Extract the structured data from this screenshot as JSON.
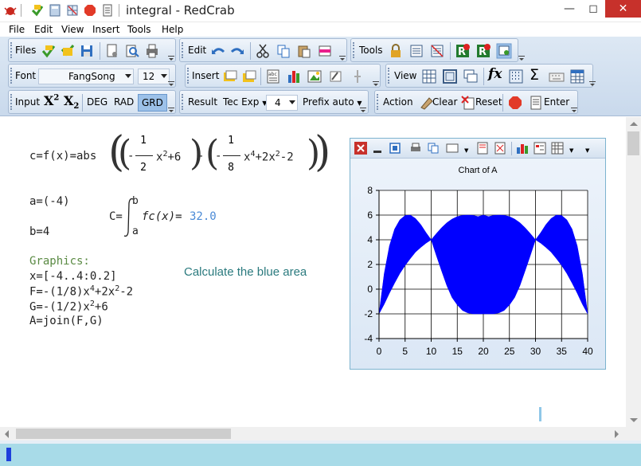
{
  "window": {
    "title": "integral - RedCrab"
  },
  "menu": [
    "File",
    "Edit",
    "View",
    "Insert",
    "Tools",
    "Help"
  ],
  "toolbar": {
    "files_label": "Files",
    "edit_label": "Edit",
    "tools_label": "Tools",
    "font_label": "Font",
    "font_family": "FangSong",
    "font_size": "12",
    "insert_label": "Insert",
    "view_label": "View",
    "input_label": "Input",
    "superscript_label": "X",
    "superscript_exp": "2",
    "subscript_label": "X",
    "subscript_idx": "2",
    "deg_label": "DEG",
    "rad_label": "RAD",
    "grd_label": "GRD",
    "result_label": "Result",
    "tec_exp_label": "Tec Exp",
    "precision_value": "4",
    "prefix_label": "Prefix auto",
    "action_label": "Action",
    "clear_label": "Clear",
    "reset_label": "Reset",
    "enter_label": "Enter"
  },
  "editor": {
    "c_def": {
      "lhs": "c=f(x)=abs",
      "frac1_num": "1",
      "frac1_den": "2",
      "term1": "x",
      "term1_exp": "2",
      "term1_rest": "+6",
      "minus": "-",
      "frac2_num": "1",
      "frac2_den": "8",
      "term2": "x",
      "term2_exp": "4",
      "term2_rest": "+2x",
      "term2_exp2": "2",
      "term2_end": "-2"
    },
    "a_def": "a=(-4)",
    "b_def": "b=4",
    "integral": {
      "lhs": "C=",
      "upper": "b",
      "lower": "a",
      "body": "fc(x)=",
      "result": "32.0"
    },
    "graphics_header": "Graphics:",
    "lines": {
      "x": "x=[-4..4:0.2]",
      "F_pre": "F=-(1/8)x",
      "F_exp1": "4",
      "F_mid": "+2x",
      "F_exp2": "2",
      "F_end": "-2",
      "G_pre": "G=-(1/2)x",
      "G_exp": "2",
      "G_end": "+6",
      "A": "A=join(F,G)"
    },
    "note": "Calculate the blue area"
  },
  "chart_data": {
    "type": "area",
    "title": "Chart of A",
    "xlabel": "",
    "ylabel": "",
    "xlim": [
      0,
      40
    ],
    "ylim": [
      -4,
      8
    ],
    "xticks": [
      0,
      5,
      10,
      15,
      20,
      25,
      30,
      35,
      40
    ],
    "yticks": [
      -4,
      -2,
      0,
      2,
      4,
      6,
      8
    ],
    "grid": true,
    "fill_color": "#0000ff",
    "description_series": [
      {
        "name": "",
        "x": [
          0,
          1,
          2,
          3,
          4,
          5,
          6,
          7,
          8,
          9,
          10,
          11,
          12,
          13,
          14,
          15,
          16,
          17,
          18,
          19,
          20,
          21,
          22,
          23,
          24,
          25,
          26,
          27,
          28,
          29,
          30,
          31,
          32,
          33,
          34,
          35,
          36,
          37,
          38,
          39,
          40
        ],
        "upper": [
          -2.0,
          1.26,
          3.51,
          4.87,
          5.62,
          5.97,
          6.0,
          5.73,
          5.23,
          4.58,
          4.0,
          4.51,
          4.98,
          5.38,
          5.68,
          5.88,
          5.98,
          6.0,
          5.98,
          5.88,
          6.0,
          5.88,
          5.98,
          6.0,
          5.98,
          5.88,
          5.68,
          5.38,
          4.98,
          4.51,
          4.0,
          4.58,
          5.23,
          5.73,
          6.0,
          5.97,
          5.62,
          4.87,
          3.51,
          1.26,
          -2.0
        ],
        "lower": [
          -2.0,
          -1.22,
          -0.32,
          0.5,
          1.28,
          1.92,
          2.48,
          3.0,
          3.38,
          3.72,
          4.0,
          2.7,
          1.48,
          0.28,
          -0.68,
          -1.28,
          -1.72,
          -1.92,
          -2.0,
          -2.0,
          -2.0,
          -2.0,
          -2.0,
          -1.92,
          -1.72,
          -1.28,
          -0.68,
          0.28,
          1.48,
          2.7,
          4.0,
          3.72,
          3.38,
          3.0,
          2.48,
          1.92,
          1.28,
          0.5,
          -0.32,
          -1.22,
          -2.0
        ]
      }
    ]
  }
}
